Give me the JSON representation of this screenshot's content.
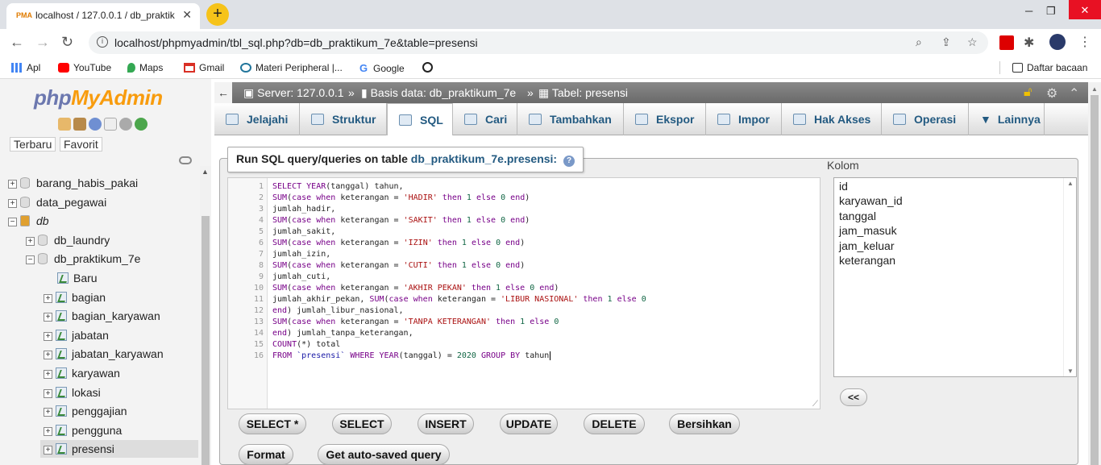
{
  "browser": {
    "tab_title": "localhost / 127.0.0.1 / db_praktik",
    "tab_close": "✕",
    "new_tab": "+",
    "win_min": "─",
    "win_max": "❐",
    "win_close": "✕",
    "url": "localhost/phpmyadmin/tbl_sql.php?db=db_praktikum_7e&table=presensi",
    "bookmarks": [
      "Apl",
      "YouTube",
      "Maps",
      "Gmail",
      "Materi Peripheral |...",
      "Google"
    ],
    "reading_list": "Daftar bacaan"
  },
  "sidebar": {
    "logo_php": "php",
    "logo_admin": "MyAdmin",
    "tab_recent": "Terbaru",
    "tab_favorite": "Favorit",
    "tree": [
      {
        "label": "barang_habis_pakai",
        "level": 0,
        "type": "db",
        "pm": "+"
      },
      {
        "label": "data_pegawai",
        "level": 0,
        "type": "db",
        "pm": "+"
      },
      {
        "label": "db",
        "level": 0,
        "type": "group",
        "pm": "−"
      },
      {
        "label": "db_laundry",
        "level": 1,
        "type": "db",
        "pm": "+"
      },
      {
        "label": "db_praktikum_7e",
        "level": 1,
        "type": "db",
        "pm": "−"
      },
      {
        "label": "Baru",
        "level": 2,
        "type": "new",
        "pm": ""
      },
      {
        "label": "bagian",
        "level": 2,
        "type": "table",
        "pm": "+"
      },
      {
        "label": "bagian_karyawan",
        "level": 2,
        "type": "table",
        "pm": "+"
      },
      {
        "label": "jabatan",
        "level": 2,
        "type": "table",
        "pm": "+"
      },
      {
        "label": "jabatan_karyawan",
        "level": 2,
        "type": "table",
        "pm": "+"
      },
      {
        "label": "karyawan",
        "level": 2,
        "type": "table",
        "pm": "+"
      },
      {
        "label": "lokasi",
        "level": 2,
        "type": "table",
        "pm": "+"
      },
      {
        "label": "penggajian",
        "level": 2,
        "type": "table",
        "pm": "+"
      },
      {
        "label": "pengguna",
        "level": 2,
        "type": "table",
        "pm": "+"
      },
      {
        "label": "presensi",
        "level": 2,
        "type": "table",
        "pm": "+",
        "selected": true
      }
    ]
  },
  "breadcrumb": {
    "server": "Server: 127.0.0.1",
    "sep": "»",
    "database": "Basis data: db_praktikum_7e",
    "table": "Tabel: presensi"
  },
  "tabs": [
    "Jelajahi",
    "Struktur",
    "SQL",
    "Cari",
    "Tambahkan",
    "Ekspor",
    "Impor",
    "Hak Akses",
    "Operasi",
    "Lainnya"
  ],
  "sql": {
    "legend_prefix": "Run SQL query/queries on table",
    "legend_table": "db_praktikum_7e.presensi:",
    "help": "?",
    "lines": [
      "SELECT YEAR(tanggal) tahun,",
      "SUM(case when keterangan = 'HADIR' then 1 else 0 end)",
      "jumlah_hadir,",
      "SUM(case when keterangan = 'SAKIT' then 1 else 0 end)",
      "jumlah_sakit,",
      "SUM(case when keterangan = 'IZIN' then 1 else 0 end)",
      "jumlah_izin,",
      "SUM(case when keterangan = 'CUTI' then 1 else 0 end)",
      "jumlah_cuti,",
      "SUM(case when keterangan = 'AKHIR PEKAN' then 1 else 0 end)",
      "jumlah_akhir_pekan, SUM(case when keterangan = 'LIBUR NASIONAL' then 1 else 0",
      "end) jumlah_libur_nasional,",
      "SUM(case when keterangan = 'TANPA KETERANGAN' then 1 else 0",
      "end) jumlah_tanpa_keterangan,",
      "COUNT(*) total",
      "FROM `presensi` WHERE YEAR(tanggal) = 2020 GROUP BY tahun"
    ],
    "columns_label": "Kolom",
    "columns": [
      "id",
      "karyawan_id",
      "tanggal",
      "jam_masuk",
      "jam_keluar",
      "keterangan"
    ],
    "insert_btn": "<<",
    "buttons": [
      "SELECT *",
      "SELECT",
      "INSERT",
      "UPDATE",
      "DELETE",
      "Bersihkan"
    ],
    "buttons2": [
      "Format",
      "Get auto-saved query"
    ]
  }
}
